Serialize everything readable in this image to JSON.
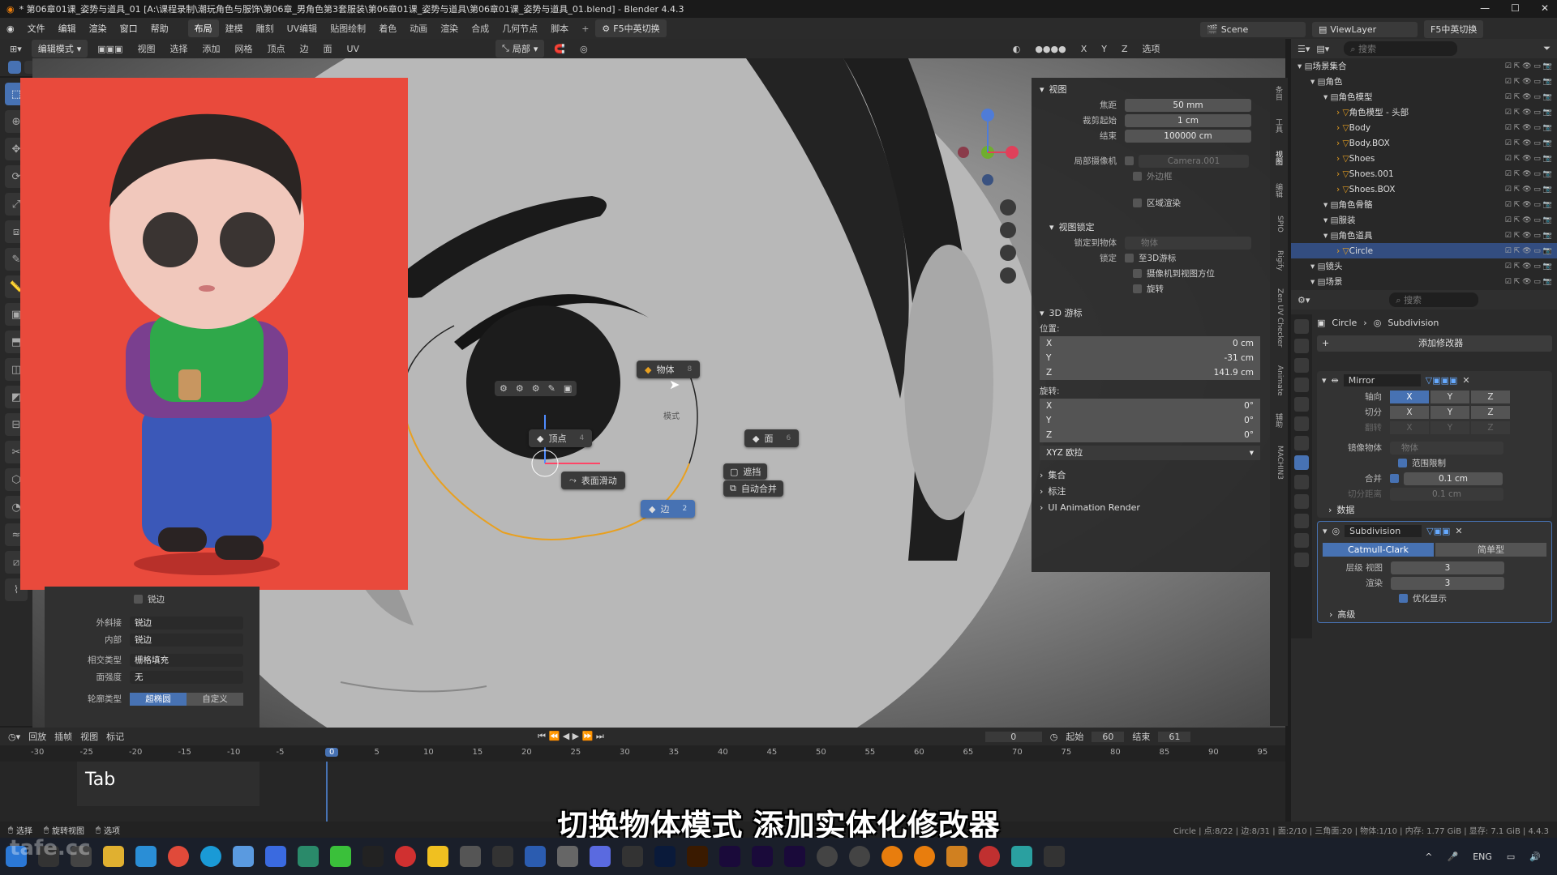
{
  "window": {
    "title": "* 第06章01课_姿势与道具_01 [A:\\课程录制\\潮玩角色与服饰\\第06章_男角色第3套服装\\第06章01课_姿势与道具\\第06章01课_姿势与道具_01.blend] - Blender 4.4.3"
  },
  "menu": {
    "items": [
      "文件",
      "编辑",
      "渲染",
      "窗口",
      "帮助"
    ],
    "workspaces": [
      "布局",
      "建模",
      "雕刻",
      "UV编辑",
      "贴图绘制",
      "着色",
      "动画",
      "渲染",
      "合成",
      "几何节点",
      "脚本"
    ],
    "lang_btn": "F5中英切换",
    "scene": "Scene",
    "view_layer": "ViewLayer",
    "lang_btn2": "F5中英切换"
  },
  "vp_header": {
    "mode": "编辑模式",
    "menus": [
      "视图",
      "选择",
      "添加",
      "网格",
      "顶点",
      "边",
      "面",
      "UV"
    ],
    "transform": "局部",
    "axes": [
      "X",
      "Y",
      "Z"
    ],
    "options": "选项"
  },
  "n_panel": {
    "view_title": "视图",
    "focal_label": "焦距",
    "focal": "50 mm",
    "clip_start_label": "裁剪起始",
    "clip_start": "1 cm",
    "clip_end_label": "结束",
    "clip_end": "100000 cm",
    "local_cam_label": "局部摄像机",
    "local_cam": "Camera.001",
    "border_label": "外边框",
    "region_label": "区域渲染",
    "lock_title": "视图锁定",
    "lock_obj_label": "锁定到物体",
    "lock_obj_ph": "物体",
    "lock_label": "锁定",
    "lock_3d": "至3D游标",
    "lock_cam": "摄像机到视图方位",
    "lock_rot": "旋转",
    "cursor_title": "3D 游标",
    "pos_label": "位置:",
    "px": "0 cm",
    "py": "-31 cm",
    "pz": "141.9 cm",
    "rot_label": "旋转:",
    "rx": "0°",
    "ry": "0°",
    "rz": "0°",
    "euler": "XYZ 欧拉",
    "coll": "集合",
    "annot": "标注",
    "uianim": "UI Animation Render"
  },
  "sidebar_tabs": [
    "条目",
    "工具",
    "视图",
    "编辑",
    "SPIO",
    "Rigify",
    "Zen UV Checker",
    "Animate",
    "辅助",
    "MACHIN3"
  ],
  "pie": {
    "obj": "物体",
    "obj_n": "8",
    "vert": "顶点",
    "vert_n": "4",
    "face": "面",
    "face_n": "6",
    "edge": "边",
    "edge_n": "2",
    "mode": "模式",
    "slide": "表面滑动",
    "occl": "遮挡",
    "automerge": "自动合并"
  },
  "outliner": {
    "search": "搜索",
    "rows": [
      {
        "name": "场景集合",
        "indent": 0
      },
      {
        "name": "角色",
        "indent": 1
      },
      {
        "name": "角色模型",
        "indent": 2
      },
      {
        "name": "角色模型 - 头部",
        "indent": 3
      },
      {
        "name": "Body",
        "indent": 3
      },
      {
        "name": "Body.BOX",
        "indent": 3
      },
      {
        "name": "Shoes",
        "indent": 3
      },
      {
        "name": "Shoes.001",
        "indent": 3
      },
      {
        "name": "Shoes.BOX",
        "indent": 3
      },
      {
        "name": "角色骨骼",
        "indent": 2
      },
      {
        "name": "服装",
        "indent": 2
      },
      {
        "name": "角色道具",
        "indent": 2
      },
      {
        "name": "Circle",
        "indent": 3
      },
      {
        "name": "镜头",
        "indent": 1
      },
      {
        "name": "场景",
        "indent": 1
      }
    ]
  },
  "props": {
    "search": "搜索",
    "crumb_obj": "Circle",
    "crumb_mod": "Subdivision",
    "add_mod": "添加修改器",
    "mirror": "Mirror",
    "axis_label": "轴向",
    "bisect_label": "切分",
    "flip_label": "翻转",
    "x": "X",
    "y": "Y",
    "z": "Z",
    "mirror_obj_label": "镜像物体",
    "mirror_obj_ph": "物体",
    "clip_label": "范围限制",
    "merge_label": "合并",
    "merge": "0.1 cm",
    "bisect_dist_label": "切分距离",
    "bisect_dist": "0.1 cm",
    "data": "数据",
    "subdiv": "Subdivision",
    "cc": "Catmull-Clark",
    "simple": "简单型",
    "levels_label": "层级 视图",
    "levels": "3",
    "render_label": "渲染",
    "render": "3",
    "optimal": "优化显示",
    "adv": "高级"
  },
  "left_panel": {
    "sharp": "锐边",
    "outer_label": "外斜接",
    "outer": "锐边",
    "inner_label": "内部",
    "inner": "锐边",
    "intersect_label": "相交类型",
    "intersect": "栅格填充",
    "face_label": "面强度",
    "face": "无",
    "profile_label": "轮廓类型",
    "superellipse": "超椭圆",
    "custom": "自定义"
  },
  "timeline": {
    "menus": [
      "回放",
      "插帧",
      "视图",
      "标记"
    ],
    "current": "0",
    "start_label": "起始",
    "start": "60",
    "end_label": "结束",
    "end": "61",
    "ticks": [
      "-30",
      "-25",
      "-20",
      "-15",
      "-10",
      "-5",
      "0",
      "5",
      "10",
      "15",
      "20",
      "25",
      "30",
      "35",
      "40",
      "45",
      "50",
      "55",
      "60",
      "65",
      "70",
      "75",
      "80",
      "85",
      "90",
      "95"
    ],
    "key": "Tab"
  },
  "status": {
    "select": "选择",
    "rotate": "旋转视图",
    "options": "选项",
    "info": "Circle | 点:8/22 | 边:8/31 | 面:2/10 | 三角面:20 | 物体:1/10 | 内存: 1.77 GiB | 显存: 7.1 GiB | 4.4.3"
  },
  "subtitle": "切换物体模式 添加实体化修改器",
  "taskbar": {
    "lang": "ENG",
    "watermark": "tafe.cc"
  }
}
